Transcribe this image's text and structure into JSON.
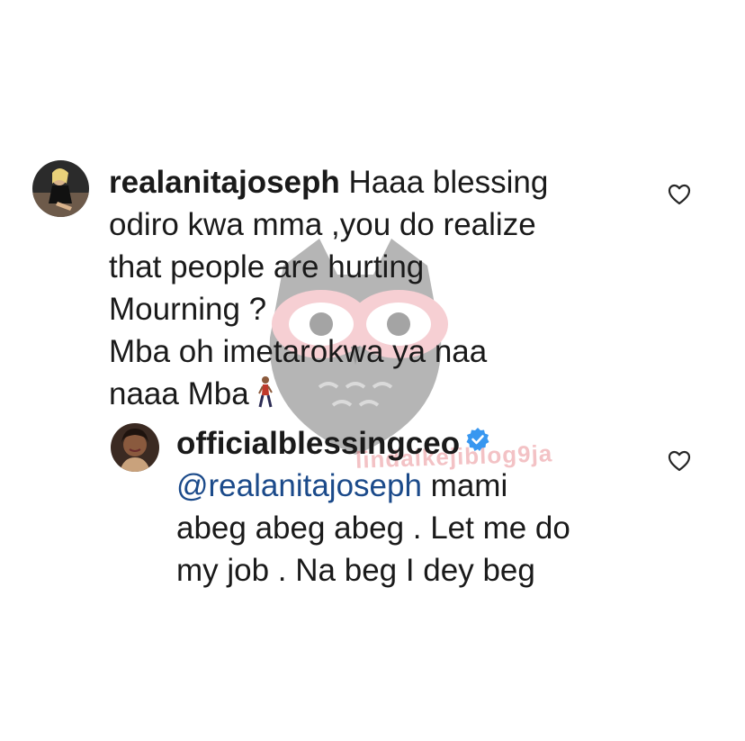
{
  "comment": {
    "username": "realanitajoseph",
    "lines": [
      "Haaa blessing",
      "odiro kwa mma ,you do realize",
      "that people are hurting",
      "Mourning ?",
      "Mba oh imetarokwa ya naa",
      "naaa Mba"
    ],
    "emoji": "person-walking-emoji",
    "like_icon": "heart-outline-icon"
  },
  "reply": {
    "username": "officialblessingceo",
    "verified_icon": "verified-badge-icon",
    "mention": "@realanitajoseph",
    "lines": [
      " mami",
      "abeg abeg abeg . Let me do",
      "my job . Na beg I dey beg"
    ],
    "like_icon": "heart-outline-icon"
  },
  "watermark": {
    "text": "lindaikejiblog9ja",
    "icon": "owl-watermark-icon"
  },
  "colors": {
    "text": "#1a1a1a",
    "mention": "#1b4a8a",
    "verified": "#3897f0",
    "heart_stroke": "#262626"
  }
}
